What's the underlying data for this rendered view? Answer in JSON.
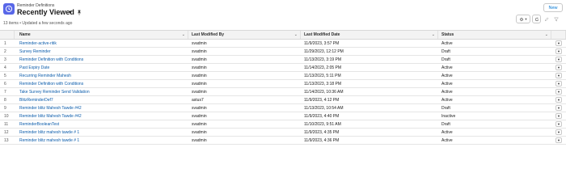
{
  "header": {
    "object_label": "Reminder Definitions",
    "view_name": "Recently Viewed",
    "new_label": "New",
    "meta": "13 items • Updated a few seconds ago"
  },
  "icons": {
    "object": "reminder-clock-icon",
    "view_switch": "chevron-down-icon",
    "pin": "pin-icon",
    "settings": "gear-icon",
    "refresh": "refresh-icon",
    "inline_edit": "pencil-icon",
    "filter": "filter-icon"
  },
  "colors": {
    "brand": "#5867e8",
    "link": "#0b5cab",
    "button_text": "#0176d3"
  },
  "columns": {
    "name": "Name",
    "modified_by": "Last Modified By",
    "modified_date": "Last Modified Date",
    "status": "Status"
  },
  "rows": [
    {
      "num": "1",
      "name": "Reminder-active-ritik",
      "by": "svadmin",
      "date": "11/9/2023, 3:57 PM",
      "status": "Active"
    },
    {
      "num": "2",
      "name": "Survey Reminder",
      "by": "svadmin",
      "date": "11/29/2023, 12:12 PM",
      "status": "Draft"
    },
    {
      "num": "3",
      "name": "Reminder Definition with Conditions",
      "by": "svadmin",
      "date": "11/13/2023, 3:19 PM",
      "status": "Draft"
    },
    {
      "num": "4",
      "name": "Past Expiry Date",
      "by": "svadmin",
      "date": "11/14/2023, 2:05 PM",
      "status": "Active"
    },
    {
      "num": "5",
      "name": "Recurring Reminder Mahesh",
      "by": "svadmin",
      "date": "11/13/2023, 5:11 PM",
      "status": "Active"
    },
    {
      "num": "6",
      "name": "Reminder Definition with Conditions",
      "by": "svadmin",
      "date": "11/13/2023, 3:18 PM",
      "status": "Active"
    },
    {
      "num": "7",
      "name": "Take Survey Reminder Send Validation",
      "by": "svadmin",
      "date": "11/14/2023, 10:36 AM",
      "status": "Active"
    },
    {
      "num": "8",
      "name": "BlitzReminderDef7",
      "by": "astus7",
      "date": "11/9/2023, 4:12 PM",
      "status": "Active"
    },
    {
      "num": "9",
      "name": "Reminder blitz Mahesh Tawde #42",
      "by": "svadmin",
      "date": "11/13/2023, 10:54 AM",
      "status": "Draft"
    },
    {
      "num": "10",
      "name": "Reminder blitz Mahesh Tawde #42",
      "by": "svadmin",
      "date": "11/9/2023, 4:40 PM",
      "status": "Inactive"
    },
    {
      "num": "11",
      "name": "ReminderBooleanTest",
      "by": "svadmin",
      "date": "11/10/2023, 9:51 AM",
      "status": "Draft"
    },
    {
      "num": "12",
      "name": "Reminder blitz mahesh tawde # 1",
      "by": "svadmin",
      "date": "11/9/2023, 4:35 PM",
      "status": "Active"
    },
    {
      "num": "13",
      "name": "Reminder blitz mahesh tawde # 1",
      "by": "svadmin",
      "date": "11/9/2023, 4:36 PM",
      "status": "Active"
    }
  ]
}
